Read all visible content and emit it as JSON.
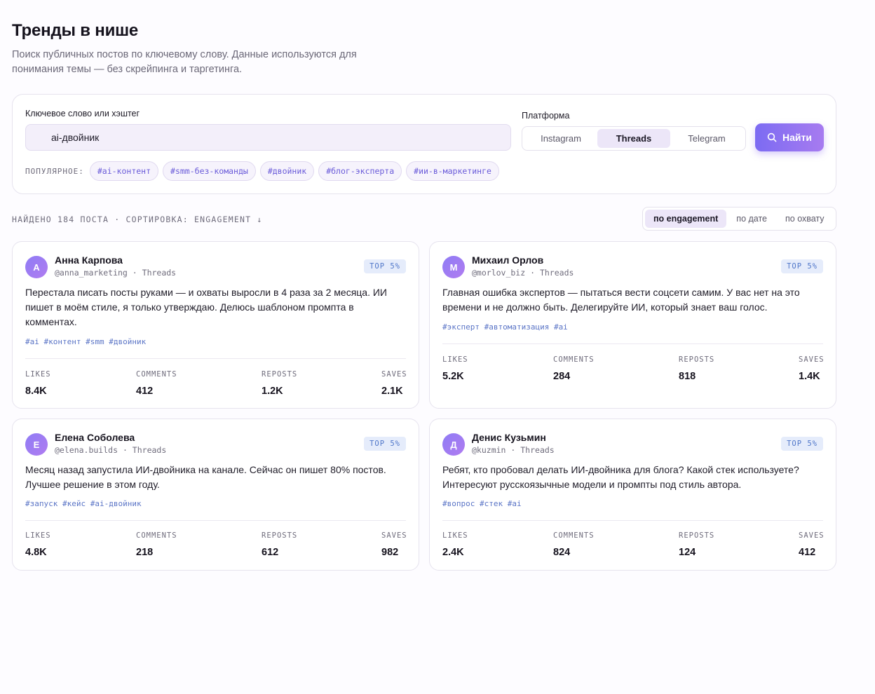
{
  "header": {
    "title": "Тренды в нише",
    "subtitle": "Поиск публичных постов по ключевому слову. Данные используются для понимания темы — без скрейпинга и таргетинга."
  },
  "search": {
    "keyword_label": "Ключевое слово или хэштег",
    "keyword_value": "ai-двойник",
    "platform_label": "Платформа",
    "platforms": [
      {
        "label": "Instagram",
        "active": false
      },
      {
        "label": "Threads",
        "active": true
      },
      {
        "label": "Telegram",
        "active": false
      }
    ],
    "find_label": "Найти",
    "find_icon": "search-icon",
    "popular_label": "ПОПУЛЯРНОЕ:",
    "popular_tags": [
      "#ai-контент",
      "#smm-без-команды",
      "#двойник",
      "#блог-эксперта",
      "#ии-в-маркетинге"
    ]
  },
  "results": {
    "summary": "НАЙДЕНО 184 ПОСТА · СОРТИРОВКА: ENGAGEMENT ↓",
    "sort_options": [
      {
        "label": "по engagement",
        "active": true
      },
      {
        "label": "по дате",
        "active": false
      },
      {
        "label": "по охвату",
        "active": false
      }
    ]
  },
  "posts": [
    {
      "initial": "А",
      "author": "Анна Карпова",
      "handle": "@anna_marketing",
      "platform": "Threads",
      "badge": "TOP 5%",
      "text": "Перестала писать посты руками — и охваты выросли в 4 раза за 2 месяца. ИИ пишет в моём стиле, я только утверждаю. Делюсь шаблоном промпта в комментах.",
      "tags": "#ai #контент #smm #двойник",
      "metrics": {
        "likes_label": "LIKES",
        "likes": "8.4K",
        "comments_label": "COMMENTS",
        "comments": "412",
        "reposts_label": "REPOSTS",
        "reposts": "1.2K",
        "saves_label": "SAVES",
        "saves": "2.1K"
      }
    },
    {
      "initial": "М",
      "author": "Михаил Орлов",
      "handle": "@morlov_biz",
      "platform": "Threads",
      "badge": "TOP 5%",
      "text": "Главная ошибка экспертов — пытаться вести соцсети самим. У вас нет на это времени и не должно быть. Делегируйте ИИ, который знает ваш голос.",
      "tags": "#эксперт #автоматизация #ai",
      "metrics": {
        "likes_label": "LIKES",
        "likes": "5.2K",
        "comments_label": "COMMENTS",
        "comments": "284",
        "reposts_label": "REPOSTS",
        "reposts": "818",
        "saves_label": "SAVES",
        "saves": "1.4K"
      }
    },
    {
      "initial": "Е",
      "author": "Елена Соболева",
      "handle": "@elena.builds",
      "platform": "Threads",
      "badge": "TOP 5%",
      "text": "Месяц назад запустила ИИ-двойника на канале. Сейчас он пишет 80% постов. Лучшее решение в этом году.",
      "tags": "#запуск #кейс #ai-двойник",
      "metrics": {
        "likes_label": "LIKES",
        "likes": "4.8K",
        "comments_label": "COMMENTS",
        "comments": "218",
        "reposts_label": "REPOSTS",
        "reposts": "612",
        "saves_label": "SAVES",
        "saves": "982"
      }
    },
    {
      "initial": "Д",
      "author": "Денис Кузьмин",
      "handle": "@kuzmin",
      "platform": "Threads",
      "badge": "TOP 5%",
      "text": "Ребят, кто пробовал делать ИИ-двойника для блога? Какой стек используете? Интересуют русскоязычные модели и промпты под стиль автора.",
      "tags": "#вопрос #стек #ai",
      "metrics": {
        "likes_label": "LIKES",
        "likes": "2.4K",
        "comments_label": "COMMENTS",
        "comments": "824",
        "reposts_label": "REPOSTS",
        "reposts": "124",
        "saves_label": "SAVES",
        "saves": "412"
      }
    }
  ],
  "colors": {
    "accent_start": "#7c6bf2",
    "accent_end": "#a77bf0",
    "badge_bg": "#e5ecfb",
    "badge_text": "#4f76c9",
    "tag_text": "#5a74c6"
  }
}
